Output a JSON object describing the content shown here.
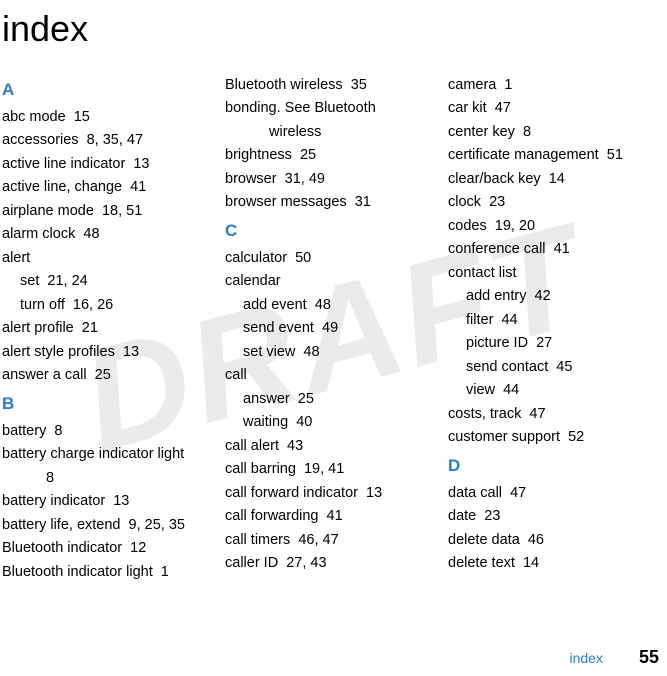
{
  "watermark": "DRAFT",
  "title": "index",
  "footer": {
    "label": "index",
    "page": "55"
  },
  "columns": [
    {
      "blocks": [
        {
          "type": "letter",
          "text": "A"
        },
        {
          "type": "entry",
          "text": "abc mode  15"
        },
        {
          "type": "entry",
          "text": "accessories  8, 35, 47"
        },
        {
          "type": "entry",
          "text": "active line indicator  13"
        },
        {
          "type": "entry",
          "text": "active line, change  41"
        },
        {
          "type": "entry",
          "text": "airplane mode  18, 51"
        },
        {
          "type": "entry",
          "text": "alarm clock  48"
        },
        {
          "type": "entry",
          "text": "alert"
        },
        {
          "type": "sub",
          "text": "set  21, 24"
        },
        {
          "type": "sub",
          "text": "turn off  16, 26"
        },
        {
          "type": "entry",
          "text": "alert profile  21"
        },
        {
          "type": "entry",
          "text": "alert style profiles  13"
        },
        {
          "type": "entry",
          "text": "answer a call  25"
        },
        {
          "type": "letter",
          "text": "B"
        },
        {
          "type": "entry",
          "text": "battery  8"
        },
        {
          "type": "entry-cont",
          "text": "battery charge indicator light",
          "cont": "8"
        },
        {
          "type": "entry",
          "text": "battery indicator  13"
        },
        {
          "type": "entry",
          "text": "battery life, extend  9, 25, 35"
        },
        {
          "type": "entry",
          "text": "Bluetooth indicator  12"
        },
        {
          "type": "entry",
          "text": "Bluetooth indicator light  1"
        }
      ]
    },
    {
      "blocks": [
        {
          "type": "entry",
          "text": "Bluetooth wireless  35"
        },
        {
          "type": "entry-cont",
          "text": "bonding. See Bluetooth",
          "cont": "wireless"
        },
        {
          "type": "entry",
          "text": "brightness  25"
        },
        {
          "type": "entry",
          "text": "browser  31, 49"
        },
        {
          "type": "entry",
          "text": "browser messages  31"
        },
        {
          "type": "letter",
          "text": "C"
        },
        {
          "type": "entry",
          "text": "calculator  50"
        },
        {
          "type": "entry",
          "text": "calendar"
        },
        {
          "type": "sub",
          "text": "add event  48"
        },
        {
          "type": "sub",
          "text": "send event  49"
        },
        {
          "type": "sub",
          "text": "set view  48"
        },
        {
          "type": "entry",
          "text": "call"
        },
        {
          "type": "sub",
          "text": "answer  25"
        },
        {
          "type": "sub",
          "text": "waiting  40"
        },
        {
          "type": "entry",
          "text": "call alert  43"
        },
        {
          "type": "entry",
          "text": "call barring  19, 41"
        },
        {
          "type": "entry",
          "text": "call forward indicator  13"
        },
        {
          "type": "entry",
          "text": "call forwarding  41"
        },
        {
          "type": "entry",
          "text": "call timers  46, 47"
        },
        {
          "type": "entry",
          "text": "caller ID  27, 43"
        }
      ]
    },
    {
      "blocks": [
        {
          "type": "entry",
          "text": "camera  1"
        },
        {
          "type": "entry",
          "text": "car kit  47"
        },
        {
          "type": "entry",
          "text": "center key  8"
        },
        {
          "type": "entry",
          "text": "certificate management  51"
        },
        {
          "type": "entry",
          "text": "clear/back key  14"
        },
        {
          "type": "entry",
          "text": "clock  23"
        },
        {
          "type": "entry",
          "text": "codes  19, 20"
        },
        {
          "type": "entry",
          "text": "conference call  41"
        },
        {
          "type": "entry",
          "text": "contact list"
        },
        {
          "type": "sub",
          "text": "add entry  42"
        },
        {
          "type": "sub",
          "text": "filter  44"
        },
        {
          "type": "sub",
          "text": "picture ID  27"
        },
        {
          "type": "sub",
          "text": "send contact  45"
        },
        {
          "type": "sub",
          "text": "view  44"
        },
        {
          "type": "entry",
          "text": "costs, track  47"
        },
        {
          "type": "entry",
          "text": "customer support  52"
        },
        {
          "type": "letter",
          "text": "D"
        },
        {
          "type": "entry",
          "text": "data call  47"
        },
        {
          "type": "entry",
          "text": "date  23"
        },
        {
          "type": "entry",
          "text": "delete data  46"
        },
        {
          "type": "entry",
          "text": "delete text  14"
        }
      ]
    }
  ]
}
